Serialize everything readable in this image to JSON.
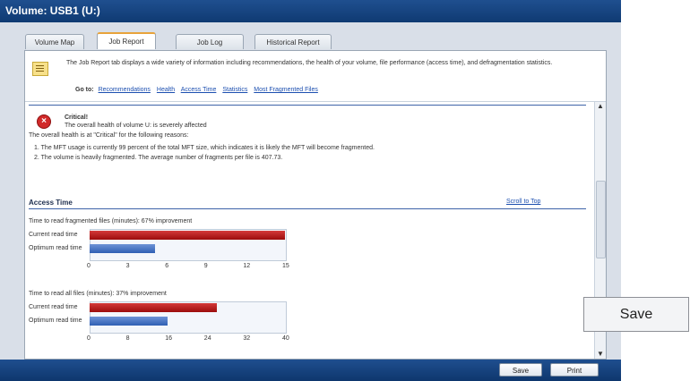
{
  "window": {
    "title": "Volume: USB1 (U:)"
  },
  "tabs": [
    {
      "label": "Volume Map"
    },
    {
      "label": "Job Report"
    },
    {
      "label": "Job Log"
    },
    {
      "label": "Historical Report"
    }
  ],
  "info": {
    "text": "The Job Report tab displays a wide variety of information including recommendations, the health of your volume, file performance (access time), and defragmentation statistics.",
    "goto_label": "Go to:",
    "links": [
      "Recommendations",
      "Health",
      "Access Time",
      "Statistics",
      "Most Fragmented Files"
    ]
  },
  "health": {
    "status": "Critical!",
    "summary": "The overall health of volume U: is severely affected",
    "reason_intro": "The overall health is at \"Critical\" for the following reasons:",
    "reasons": [
      "1. The MFT usage is currently 99 percent of the total MFT size, which indicates it is likely the MFT will become fragmented.",
      "2. The volume is heavily fragmented. The average number of fragments per file is 407.73."
    ]
  },
  "access_time": {
    "heading": "Access Time",
    "scroll_top": "Scroll to Top"
  },
  "chart_data": [
    {
      "type": "bar",
      "title": "Time to read fragmented files (minutes): 67% improvement",
      "categories": [
        "Current read time",
        "Optimum read time"
      ],
      "values": [
        15,
        5
      ],
      "colors": [
        "#b01818",
        "#3b6cc0"
      ],
      "xticks": [
        "0",
        "3",
        "6",
        "9",
        "12",
        "15"
      ],
      "xlim": [
        0,
        15
      ]
    },
    {
      "type": "bar",
      "title": "Time to read all files (minutes): 37% improvement",
      "categories": [
        "Current read time",
        "Optimum read time"
      ],
      "values": [
        26,
        16
      ],
      "colors": [
        "#b01818",
        "#3b6cc0"
      ],
      "xticks": [
        "0",
        "8",
        "16",
        "24",
        "32",
        "40"
      ],
      "xlim": [
        0,
        40
      ]
    }
  ],
  "buttons": {
    "save": "Save",
    "print": "Print"
  },
  "overlay": {
    "save": "Save"
  }
}
